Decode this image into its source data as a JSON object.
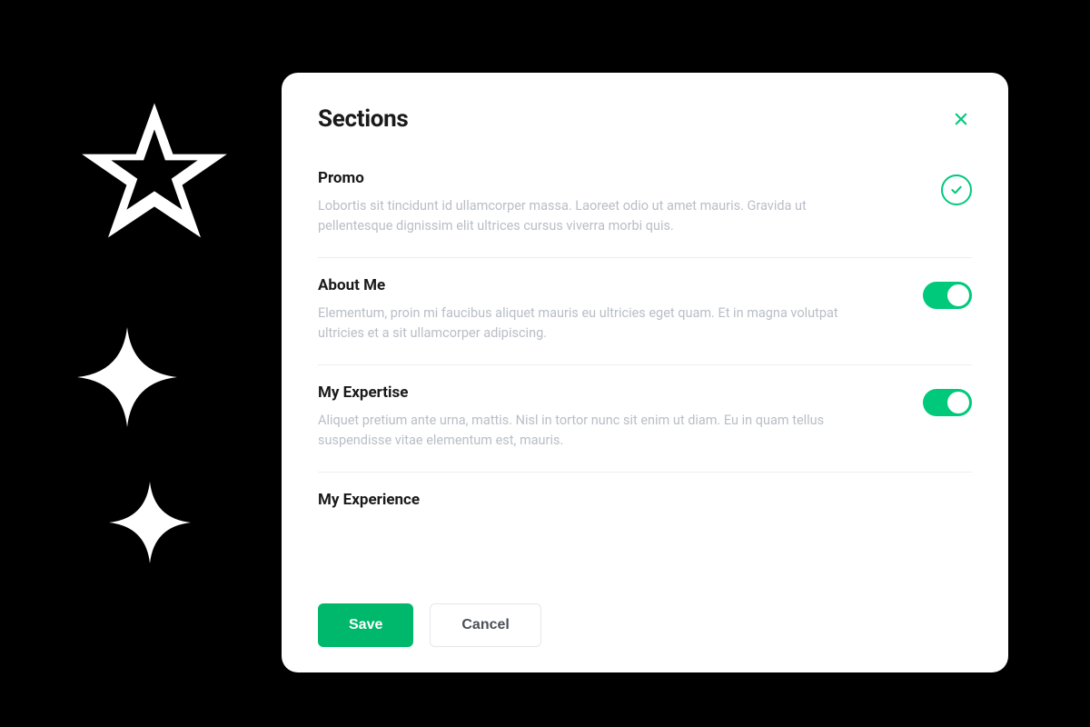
{
  "modal": {
    "title": "Sections",
    "sections": [
      {
        "title": "Promo",
        "description": "Lobortis sit tincidunt id ullamcorper massa. Laoreet odio ut amet mauris. Gravida ut pellentesque dignissim elit ultrices cursus viverra morbi quis.",
        "control": "check"
      },
      {
        "title": "About Me",
        "description": "Elementum, proin mi faucibus aliquet mauris eu ultricies eget quam. Et in magna volutpat ultricies et a sit ullamcorper adipiscing.",
        "control": "toggle-on"
      },
      {
        "title": "My Expertise",
        "description": "Aliquet pretium ante urna, mattis. Nisl in tortor nunc sit enim ut diam. Eu in quam tellus suspendisse vitae elementum est, mauris.",
        "control": "toggle-on"
      },
      {
        "title": "My Experience",
        "description": "",
        "control": ""
      }
    ],
    "buttons": {
      "save": "Save",
      "cancel": "Cancel"
    }
  },
  "colors": {
    "accent": "#00c97b",
    "primary_btn": "#00b86b"
  }
}
